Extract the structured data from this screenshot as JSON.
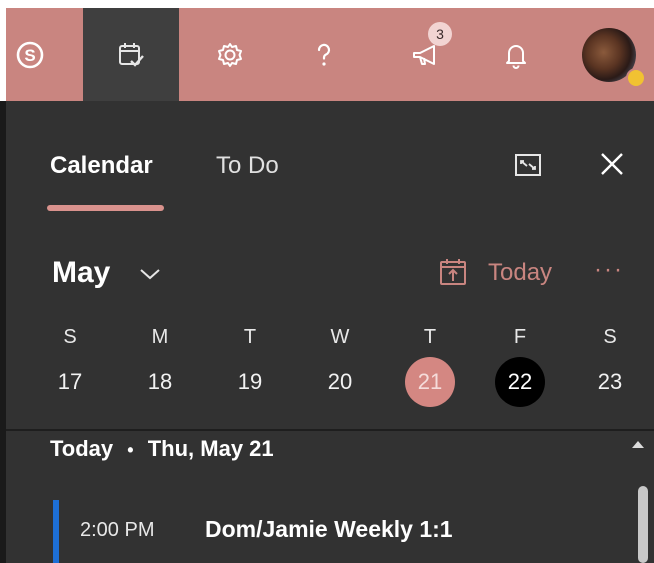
{
  "topbar": {
    "buttons": [
      {
        "name": "skype",
        "icon": "skype-icon"
      },
      {
        "name": "my-day",
        "icon": "calendar-check-icon",
        "active": true
      },
      {
        "name": "settings",
        "icon": "gear-icon"
      },
      {
        "name": "help",
        "icon": "question-mark-icon"
      },
      {
        "name": "whats-new",
        "icon": "megaphone-icon",
        "badge": "3"
      },
      {
        "name": "notifications",
        "icon": "bell-icon"
      }
    ],
    "whats_new_badge": "3",
    "colors": {
      "bar": "#c98580",
      "active": "#3f3f3f"
    }
  },
  "panel": {
    "tabs": [
      {
        "label": "Calendar",
        "selected": true
      },
      {
        "label": "To Do",
        "selected": false
      }
    ],
    "month_label": "May",
    "today_label": "Today",
    "more_label": "···",
    "weekdays": [
      "S",
      "M",
      "T",
      "W",
      "T",
      "F",
      "S"
    ],
    "days": [
      "17",
      "18",
      "19",
      "20",
      "21",
      "22",
      "23"
    ],
    "selected_day": "21",
    "current_day": "22",
    "agenda_heading": "Today",
    "agenda_separator": "•",
    "agenda_date": "Thu, May 21",
    "events": [
      {
        "time": "2:00 PM",
        "title": "Dom/Jamie Weekly 1:1",
        "color": "#1d6fd6"
      }
    ],
    "colors": {
      "background": "#323232",
      "accent": "#d9928d",
      "selected_day": "#d48782",
      "current_day": "#000000"
    }
  }
}
